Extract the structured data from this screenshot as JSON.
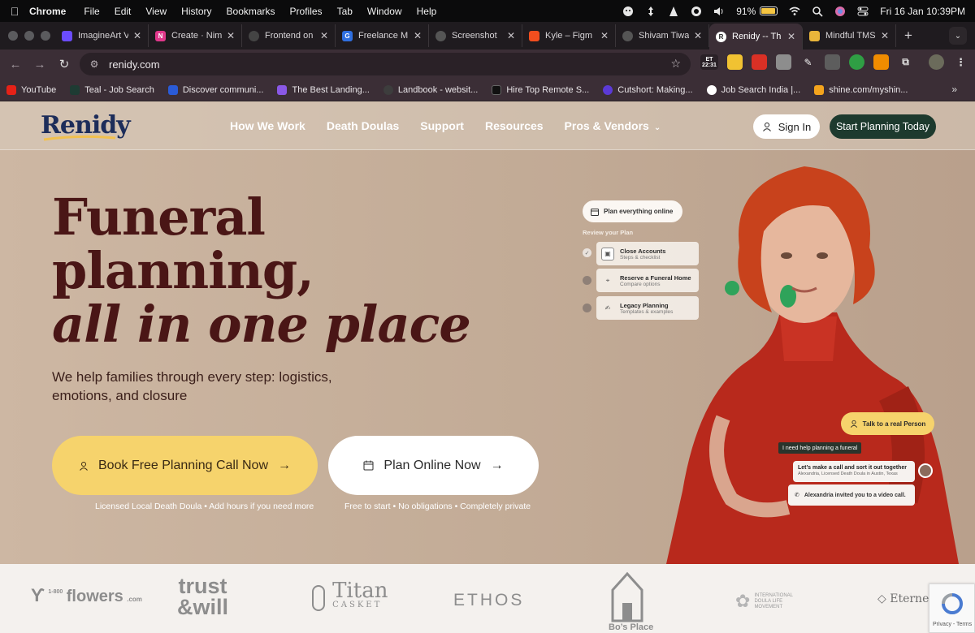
{
  "menubar": {
    "app_name": "Chrome",
    "items": [
      "File",
      "Edit",
      "View",
      "History",
      "Bookmarks",
      "Profiles",
      "Tab",
      "Window",
      "Help"
    ],
    "battery": "91%",
    "battery_level": 0.91,
    "datetime": "Fri 16 Jan  10:39PM"
  },
  "tabs": [
    {
      "label": "ImagineArt V",
      "favicon_color": "#6b4cff"
    },
    {
      "label": "Create · Nim",
      "favicon_color": "#e0388b"
    },
    {
      "label": "Frontend on",
      "favicon_color": "#444444"
    },
    {
      "label": "Freelance M",
      "favicon_color": "#2f6fe0"
    },
    {
      "label": "Screenshot",
      "favicon_color": "#555555"
    },
    {
      "label": "Kyle – Figm",
      "favicon_color": "#f24e1e"
    },
    {
      "label": "Shivam Tiwa",
      "favicon_color": "#555555"
    },
    {
      "label": "Renidy -- Th",
      "favicon_color": "#ffffff",
      "active": true
    },
    {
      "label": "Mindful TMS",
      "favicon_color": "#e9b53a"
    }
  ],
  "toolbar": {
    "url": "renidy.com",
    "ext_badge": "ET\n22:31"
  },
  "bookmarks": [
    {
      "label": "YouTube",
      "color": "#e62117"
    },
    {
      "label": "Teal - Job Search",
      "color": "#1e3b33"
    },
    {
      "label": "Discover communi...",
      "color": "#2a5bd7"
    },
    {
      "label": "The Best Landing...",
      "color": "#8a58e6"
    },
    {
      "label": "Landbook - websit...",
      "color": "#3d3d3d"
    },
    {
      "label": "Hire Top Remote S...",
      "color": "#111111"
    },
    {
      "label": "Cutshort: Making...",
      "color": "#5b3ad6"
    },
    {
      "label": "Job Search India |...",
      "color": "#ffffff"
    },
    {
      "label": "shine.com/myshin...",
      "color": "#f4a41d"
    }
  ],
  "site": {
    "logo": "Renidy",
    "nav": [
      "How We Work",
      "Death Doulas",
      "Support",
      "Resources",
      "Pros & Vendors"
    ],
    "signin": "Sign In",
    "start": "Start Planning Today"
  },
  "hero": {
    "title_line1": "Funeral",
    "title_line2": "planning,",
    "title_line3": "all in one place",
    "subtitle": "We help families through every step: logistics, emotions, and closure",
    "cta_primary": "Book Free Planning Call Now",
    "cta_primary_note": "Licensed Local Death Doula • Add hours if you need more",
    "cta_secondary": "Plan Online Now",
    "cta_secondary_note": "Free to start • No obligations • Completely private"
  },
  "plan_widget": {
    "pill": "Plan everything online",
    "review_label": "Review your Plan",
    "steps": [
      {
        "title": "Close Accounts",
        "sub": "Steps & checklist"
      },
      {
        "title": "Reserve a Funeral Home",
        "sub": "Compare options"
      },
      {
        "title": "Legacy Planning",
        "sub": "Templates & examples"
      }
    ]
  },
  "chat_widget": {
    "talk": "Talk to a real Person",
    "need_help": "I need help planning a funeral",
    "call_title": "Let’s make a call and sort it out together",
    "call_sub": "Alexandria, Licensed Death Doula in Austin, Texas",
    "invite": "Alexandria invited you to a video call."
  },
  "partners": {
    "p1_small": "1-800",
    "p1": "flowers",
    "p1_suffix": ".com",
    "p2_line1": "trust",
    "p2_line2": "&will",
    "p3": "Titan",
    "p3_sub": "CASKET",
    "p4": "ETHOS",
    "p5": "Bo’s Place",
    "p6_line1": "INTERNATIONAL",
    "p6_line2": "DOULA LIFE",
    "p6_line3": "MOVEMENT",
    "p7": "Eterneva"
  },
  "recaptcha": {
    "text": "Privacy - Terms"
  },
  "colors": {
    "hero_text": "#4a1616",
    "cta_yellow": "#f6d36c",
    "start_green": "#1d3a2e",
    "logo_navy": "#1d2d5a"
  }
}
